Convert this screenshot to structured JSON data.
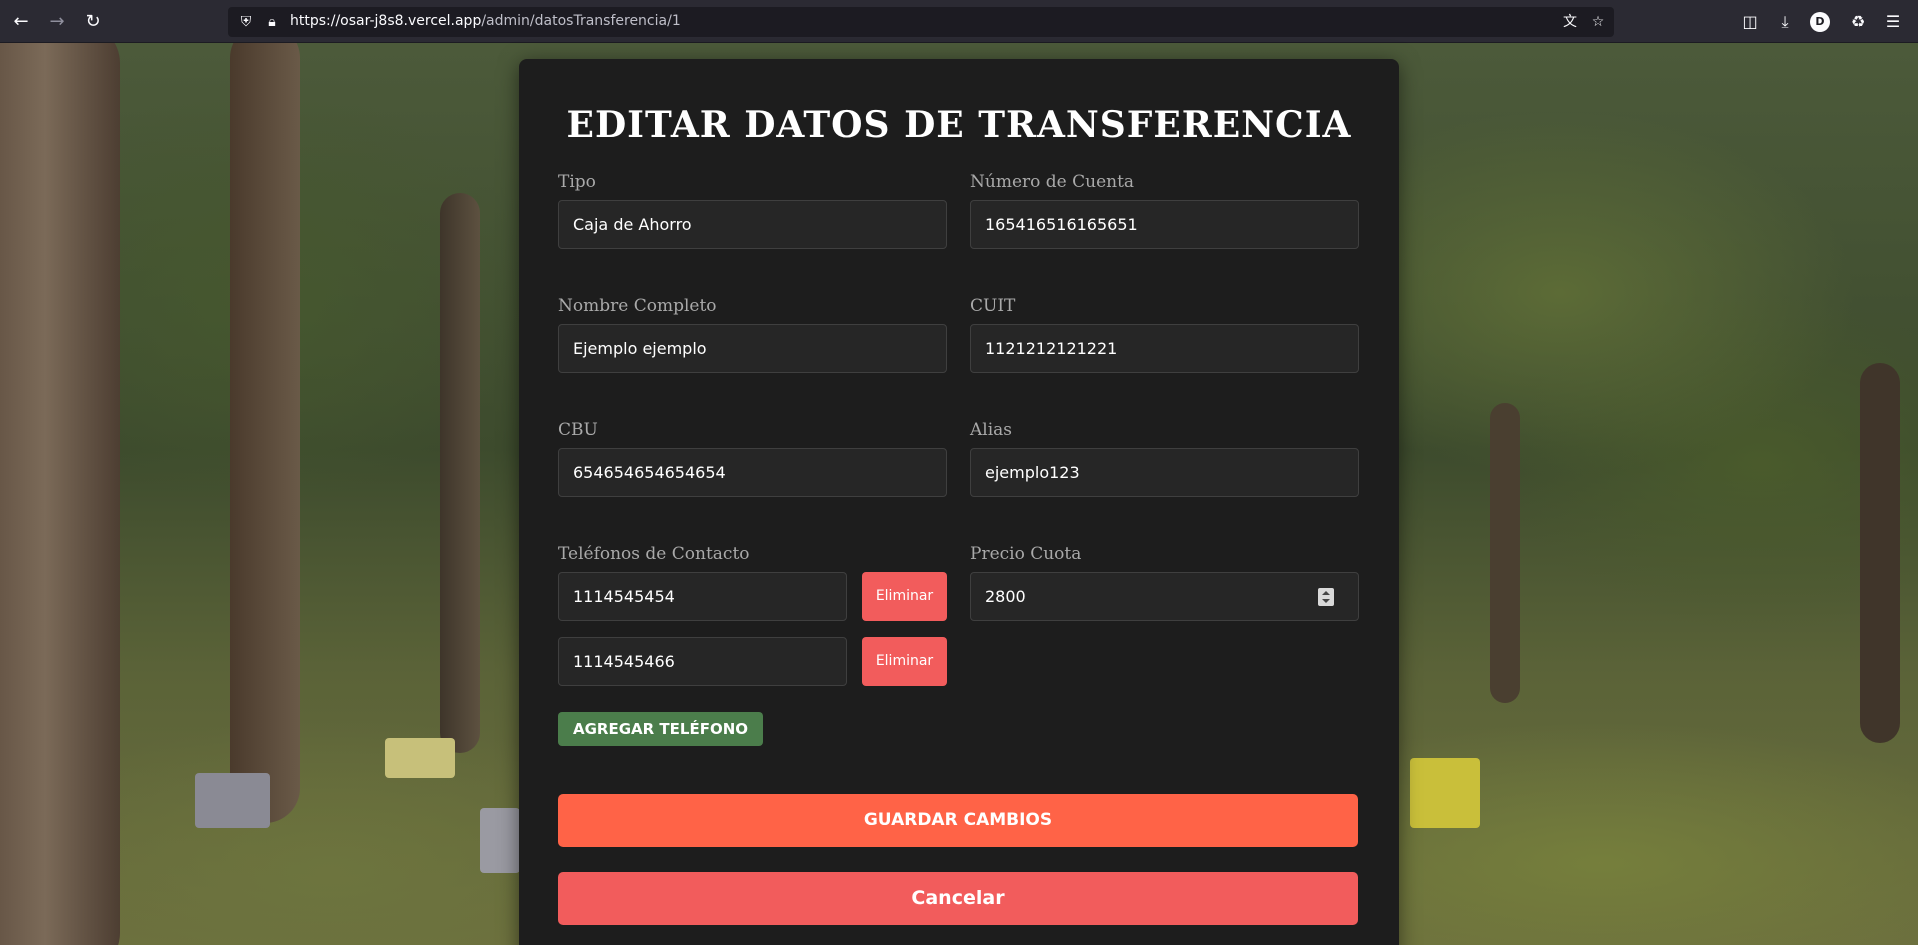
{
  "browser": {
    "url_host": "https://osar-j8s8.vercel.app",
    "url_path": "/admin/datosTransferencia/1",
    "profile_initial": "D",
    "icons": [
      "back-icon",
      "forward-icon",
      "reload-icon",
      "shield-icon",
      "lock-icon",
      "translate-icon",
      "bookmark-star-icon",
      "pocket-icon",
      "downloads-icon",
      "account-icon",
      "extensions-icon",
      "menu-icon"
    ]
  },
  "form": {
    "title": "EDITAR DATOS DE TRANSFERENCIA",
    "tipo": {
      "label": "Tipo",
      "value": "Caja de Ahorro"
    },
    "numero_cuenta": {
      "label": "Número de Cuenta",
      "value": "165416516165651"
    },
    "nombre_completo": {
      "label": "Nombre Completo",
      "value": "Ejemplo ejemplo"
    },
    "cuit": {
      "label": "CUIT",
      "value": "1121212121221"
    },
    "cbu": {
      "label": "CBU",
      "value": "654654654654654"
    },
    "alias": {
      "label": "Alias",
      "value": "ejemplo123"
    },
    "telefonos": {
      "label": "Teléfonos de Contacto",
      "items": [
        {
          "value": "1114545454",
          "delete_label": "Eliminar"
        },
        {
          "value": "1114545466",
          "delete_label": "Eliminar"
        }
      ],
      "add_label": "AGREGAR TELÉFONO"
    },
    "precio_cuota": {
      "label": "Precio Cuota",
      "value": "2800"
    },
    "save_label": "GUARDAR CAMBIOS",
    "cancel_label": "Cancelar"
  },
  "colors": {
    "card_bg": "#1d1d1d",
    "save_button": "#ff6347",
    "cancel_button": "#f25c5c",
    "delete_button": "#f25c5c",
    "add_button": "#4b7d4b"
  }
}
